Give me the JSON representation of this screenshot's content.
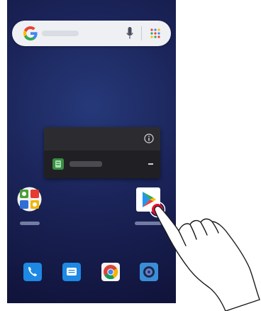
{
  "search_bar": {
    "icon": "google-g-icon",
    "mic_icon": "microphone-icon",
    "apps_icon": "apps-grid-icon"
  },
  "popup": {
    "info_icon": "info-icon",
    "app_icon": "app-shortcut-icon",
    "menu_icon": "minus-icon"
  },
  "home_icons": [
    "folder-icon",
    "play-store-icon"
  ],
  "dock": [
    "phone-icon",
    "messages-icon",
    "chrome-icon",
    "camera-icon"
  ],
  "colors": {
    "wallpaper": "#1b2459",
    "tap_marker": "#e4122e",
    "search_bg": "#eef0f4"
  }
}
